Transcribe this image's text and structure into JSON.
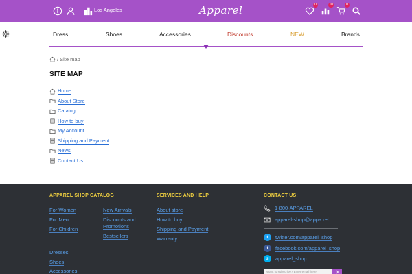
{
  "header": {
    "city": "Los Angeles",
    "logo": "Apparel",
    "wishlist_count": "0",
    "compare_count": "10",
    "cart_count": "0",
    "accent_color": "#a552c8"
  },
  "nav": {
    "items": [
      "Dress",
      "Shoes",
      "Accessories",
      "Discounts",
      "NEW",
      "Brands"
    ],
    "colors": {
      "discounts": "#c0392b",
      "new": "#d79b2b"
    }
  },
  "breadcrumb": {
    "current": "Site map"
  },
  "page_title": "SITE MAP",
  "sitemap": {
    "items": [
      {
        "label": "Home",
        "icon": "home-icon"
      },
      {
        "label": "About Store",
        "icon": "folder-icon"
      },
      {
        "label": "Catalog",
        "icon": "folder-icon"
      },
      {
        "label": "How to buy",
        "icon": "document-icon"
      },
      {
        "label": "My Account",
        "icon": "folder-icon"
      },
      {
        "label": "Shipping and Payment",
        "icon": "document-icon"
      },
      {
        "label": "News",
        "icon": "folder-icon"
      },
      {
        "label": "Contact Us",
        "icon": "document-icon"
      }
    ]
  },
  "footer": {
    "catalog": {
      "title": "APPAREL SHOP CATALOG",
      "col1": [
        "For Women",
        "For Men",
        "For Children"
      ],
      "col2": [
        "New Arrivals",
        "Discounts and",
        "Promotions",
        "Bestsellers"
      ],
      "col3": [
        "Dresses",
        "Shoes",
        "Accessories"
      ]
    },
    "services": {
      "title": "SERVICES AND HELP",
      "links": [
        "About store",
        "How to buy",
        "Shipping and Payment",
        "Warranty"
      ]
    },
    "contact": {
      "title": "CONTACT US:",
      "phone": "1-800-APPAREL",
      "email": "apparel-shop@appa.rel",
      "twitter": "twitter.com/apparel_shop",
      "facebook": "facebook.com/apparel_shop",
      "skype": "apparel_shop",
      "newsletter_placeholder": "Want to subscribe? Enter email here"
    }
  }
}
